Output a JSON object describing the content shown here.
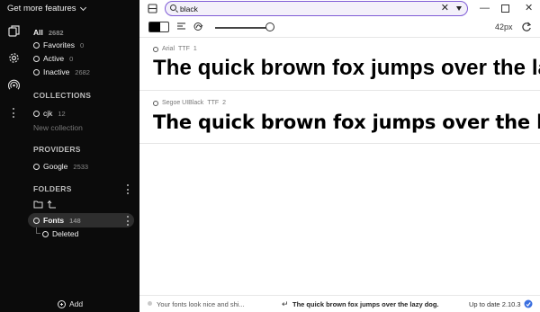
{
  "sidebar": {
    "feature_menu": "Get more features",
    "library": [
      {
        "label": "All",
        "count": "2682"
      },
      {
        "label": "Favorites",
        "count": "0"
      },
      {
        "label": "Active",
        "count": "0"
      },
      {
        "label": "Inactive",
        "count": "2682"
      }
    ],
    "collections_heading": "COLLECTIONS",
    "collections": [
      {
        "label": "cjk",
        "count": "12"
      }
    ],
    "new_collection": "New collection",
    "providers_heading": "PROVIDERS",
    "providers": [
      {
        "label": "Google",
        "count": "2533"
      }
    ],
    "folders_heading": "FOLDERS",
    "folders": [
      {
        "label": "Fonts",
        "count": "148"
      },
      {
        "label": "Deleted",
        "count": ""
      }
    ],
    "add_label": "Add"
  },
  "search": {
    "value": "black",
    "placeholder": ""
  },
  "toolbar": {
    "size_label": "42px",
    "size_value": 42,
    "colors": {
      "foreground": "#000000",
      "background": "#ffffff",
      "accent": "#7e5bd6"
    }
  },
  "fonts": [
    {
      "name": "Arial",
      "format": "TTF",
      "styles": "1",
      "sample": "The quick brown fox jumps over the lazy dog."
    },
    {
      "name": "Segoe UIBlack",
      "format": "TTF",
      "styles": "2",
      "sample": "The quick brown fox jumps over the lazy dog."
    }
  ],
  "status": {
    "message": "Your fonts look nice and shi...",
    "preview_text": "The quick brown fox jumps over the lazy dog.",
    "version": "Up to date 2.10.3"
  }
}
